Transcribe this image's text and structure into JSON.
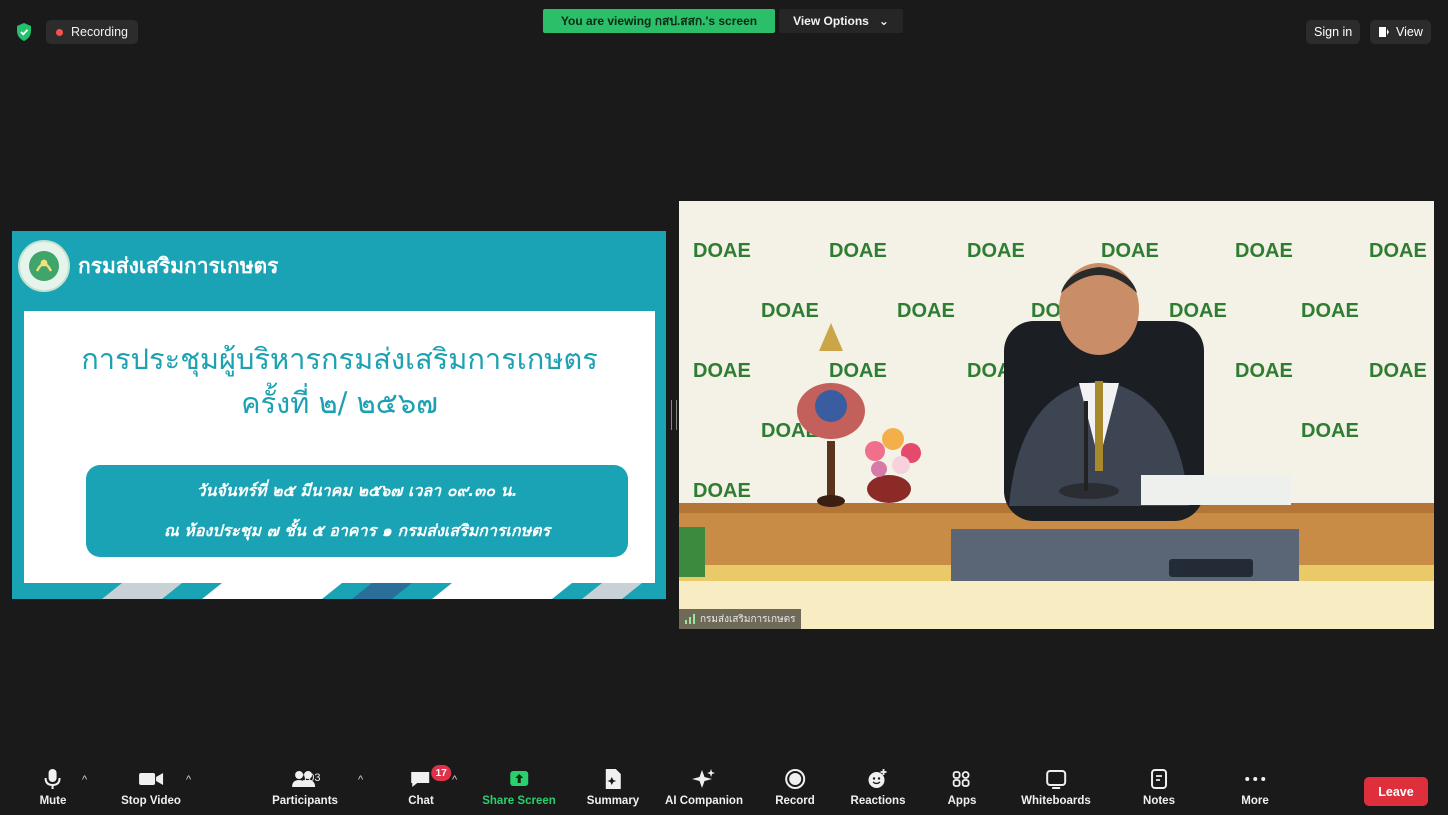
{
  "topbar": {
    "recording_label": "Recording",
    "viewing_text": "You are viewing กสป.สสก.'s screen",
    "view_options_label": "View Options",
    "sign_in_label": "Sign in",
    "view_label": "View"
  },
  "slide": {
    "department": "กรมส่งเสริมการเกษตร",
    "title_line1": "การประชุมผู้บริหารกรมส่งเสริมการเกษตร",
    "title_line2": "ครั้งที่ ๒/ ๒๕๖๗",
    "date_line": "วันจันทร์ที่ ๒๕ มีนาคม ๒๕๖๗ เวลา ๐๙.๓๐ น.",
    "location_line": "ณ ห้องประชุม ๗ ชั้น ๕ อาคาร ๑ กรมส่งเสริมการเกษตร"
  },
  "video": {
    "backdrop_logo": "DOAE",
    "participant_name": "กรมส่งเสริมการเกษตร"
  },
  "toolbar": {
    "mute": "Mute",
    "stop_video": "Stop Video",
    "participants": "Participants",
    "participants_count": "103",
    "chat": "Chat",
    "chat_badge": "17",
    "share_screen": "Share Screen",
    "summary": "Summary",
    "ai_companion": "AI Companion",
    "record": "Record",
    "reactions": "Reactions",
    "apps": "Apps",
    "whiteboards": "Whiteboards",
    "notes": "Notes",
    "more": "More",
    "leave": "Leave"
  },
  "colors": {
    "accent_green": "#2bbf6a",
    "slide_teal": "#1aa2b5",
    "leave_red": "#e02f3c",
    "backdrop_green": "#2e7d32"
  }
}
